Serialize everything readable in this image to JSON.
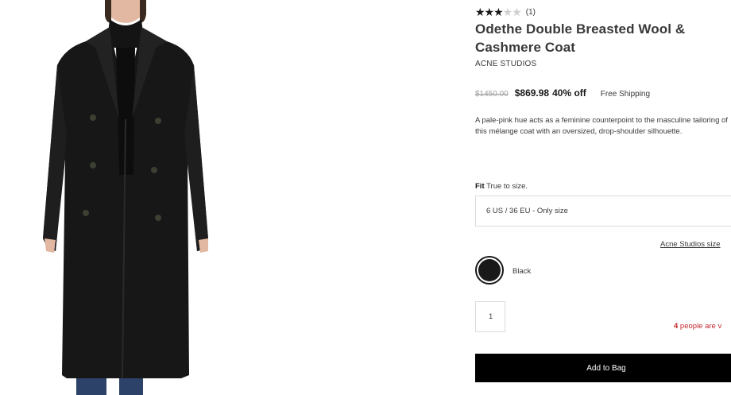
{
  "product": {
    "rating": {
      "stars_filled": 3,
      "stars_total": 5,
      "review_count": "(1)"
    },
    "title": "Odethe Double Breasted Wool & Cashmere Coat",
    "brand": "ACNE STUDIOS",
    "price": {
      "original": "$1450.00",
      "sale": "$869.98",
      "discount": "40% off",
      "shipping": "Free Shipping"
    },
    "description": "A pale-pink hue acts as a feminine counterpoint to the masculine tailoring of this mélange coat with an oversized, drop-shoulder silhouette.",
    "fit": {
      "label": "Fit",
      "value": "True to size."
    },
    "size_select": {
      "value": "6 US / 36 EU  - Only size"
    },
    "size_guide_link": "Acne Studios size",
    "color": {
      "name": "Black",
      "swatch": "#191919"
    },
    "quantity": "1",
    "viewing": {
      "count": "4",
      "text": " people are v"
    },
    "add_to_bag": "Add to Bag"
  },
  "colors": {
    "accent": "#000000",
    "alert": "#c0272d",
    "text": "#393939"
  }
}
